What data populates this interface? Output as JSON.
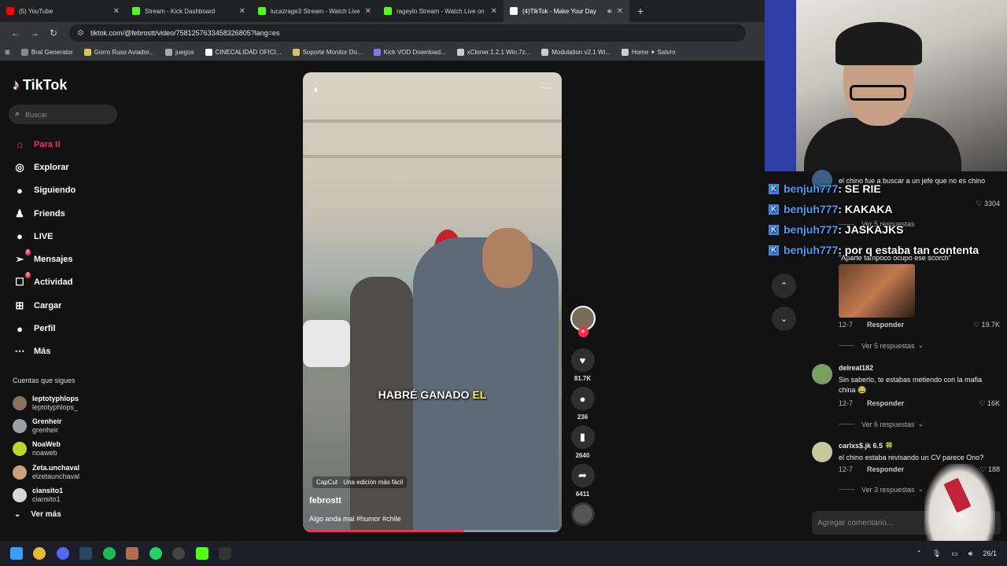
{
  "browser": {
    "tabs": [
      {
        "title": "(5) YouTube",
        "color": "#ff0000"
      },
      {
        "title": "Stream - Kick Dashboard",
        "color": "#53fc18"
      },
      {
        "title": "lucazrage3 Stream - Watch Live",
        "color": "#53fc18"
      },
      {
        "title": "rageylo Stream - Watch Live on",
        "color": "#53fc18"
      },
      {
        "title": "(4)TikTok - Make Your Day",
        "color": "#ffffff"
      }
    ],
    "url": "tiktok.com/@febrostt/video/7581257633458326805?lang=es",
    "bookmarks": [
      {
        "label": "Brat Generator",
        "color": "#888888"
      },
      {
        "label": "Gorro Ruso Aviador...",
        "color": "#e0c060"
      },
      {
        "label": "juegos",
        "color": "#aaaaaa"
      },
      {
        "label": "CINECALIDAD OFICI...",
        "color": "#ffffff"
      },
      {
        "label": "Soporte Monitor Do...",
        "color": "#e0c060"
      },
      {
        "label": "Kick VOD Download...",
        "color": "#7c7cf0"
      },
      {
        "label": "xCloner.1.2.1 Win.7z...",
        "color": "#cccccc"
      },
      {
        "label": "Modulation v2.1 Wi...",
        "color": "#cccccc"
      },
      {
        "label": "Home ✦ Satvrn",
        "color": "#cccccc"
      }
    ]
  },
  "tiktok": {
    "logo": "TikTok",
    "search_placeholder": "Buscar",
    "nav": [
      {
        "label": "Para ti",
        "icon": "home-icon",
        "glyph": "⌂"
      },
      {
        "label": "Explorar",
        "icon": "compass-icon",
        "glyph": "◎"
      },
      {
        "label": "Siguiendo",
        "icon": "following-icon",
        "glyph": "●"
      },
      {
        "label": "Friends",
        "icon": "friends-icon",
        "glyph": "♟"
      },
      {
        "label": "LIVE",
        "icon": "live-icon",
        "glyph": "●"
      },
      {
        "label": "Mensajes",
        "icon": "send-icon",
        "glyph": "➢",
        "badge": "2"
      },
      {
        "label": "Actividad",
        "icon": "activity-icon",
        "glyph": "☐",
        "badge": "2"
      },
      {
        "label": "Cargar",
        "icon": "upload-icon",
        "glyph": "⊞"
      },
      {
        "label": "Perfil",
        "icon": "profile-icon",
        "glyph": "●"
      },
      {
        "label": "Más",
        "icon": "more-icon",
        "glyph": "⋯"
      }
    ],
    "following_title": "Cuentas que sigues",
    "following": [
      {
        "name": "leptotyphlops",
        "handle": "leptotyphlops_",
        "color": "#8a7060"
      },
      {
        "name": "Grenheir",
        "handle": "grenheir",
        "color": "#9aa0a8"
      },
      {
        "name": "NoaWeb",
        "handle": "noaweb",
        "color": "#b8d830"
      },
      {
        "name": "Zeta.unchaval",
        "handle": "elzetaunchaval",
        "color": "#c9a27a"
      },
      {
        "name": "ciansito1",
        "handle": "ciansito1",
        "color": "#d8d8d8"
      }
    ],
    "see_more": "Ver más",
    "video": {
      "caption_main": "HABRÉ GANADO",
      "caption_highlight": "EL",
      "capcut": "CapCut · Una edición más fácil",
      "author": "febrostt",
      "description": "Algo anda mal #humor #chile",
      "progress": 0.62
    },
    "actions": {
      "likes": "81.7K",
      "comments": "236",
      "saves": "2640",
      "shares": "6411"
    },
    "comments": [
      {
        "user": "delreal182",
        "text": "Sin saberlo, te estabas metiendo con la mafia china 😂",
        "date": "12-7",
        "likes": "16K",
        "replies": "Ver 6 respuestas",
        "color": "#7aa060"
      },
      {
        "user": "carlxs$.jk 6.5 🍀",
        "text": "el chino estaba revisando un CV parece Ono?",
        "date": "12-7",
        "likes": "188",
        "replies": "Ver 3 respuestas",
        "color": "#c8c8a0"
      }
    ],
    "partial_comment": {
      "text": "el chino fue a buscar a un jefe que no es chino",
      "likes": "3304",
      "replies": "Ver 5 respuestas",
      "quote": "\"Aparte tampoco ocupo ese scorch\"",
      "date": "12-7",
      "likes2": "19.7K",
      "replies2": "Ver 5 respuestas"
    },
    "reply_label": "Responder",
    "add_comment_placeholder": "Agregar comentario..."
  },
  "chat": [
    {
      "user": "benjuh777",
      "msg": ": SE RIE"
    },
    {
      "user": "benjuh777",
      "msg": ": KAKAKA"
    },
    {
      "user": "benjuh777",
      "msg": ": JASKAJKS"
    },
    {
      "user": "benjuh777",
      "msg": ": por q estaba tan contenta"
    }
  ],
  "taskbar": {
    "apps": [
      "windows-icon",
      "chrome-icon",
      "discord-icon",
      "steam-icon",
      "spotify-icon",
      "app-icon",
      "whatsapp-icon",
      "obs-icon",
      "kick-icon",
      "epic-icon"
    ],
    "clock": "26/1"
  }
}
